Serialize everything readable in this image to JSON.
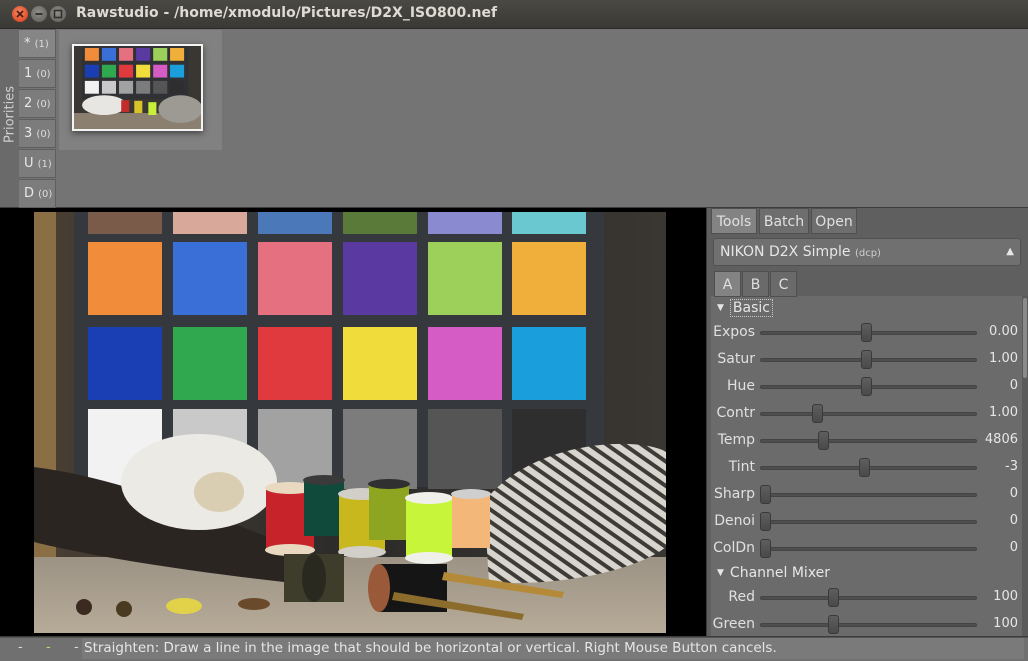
{
  "window": {
    "title": "Rawstudio - /home/xmodulo/Pictures/D2X_ISO800.nef"
  },
  "priorities": {
    "label": "Priorities",
    "tabs": [
      {
        "label": "*",
        "count": "(1)"
      },
      {
        "label": "1",
        "count": "(0)"
      },
      {
        "label": "2",
        "count": "(0)"
      },
      {
        "label": "3",
        "count": "(0)"
      },
      {
        "label": "U",
        "count": "(1)"
      },
      {
        "label": "D",
        "count": "(0)"
      }
    ]
  },
  "tools_tabs": [
    "Tools",
    "Batch",
    "Open"
  ],
  "profile": {
    "name": "NIKON D2X Simple",
    "type": "(dcp)"
  },
  "subtabs": [
    "A",
    "B",
    "C"
  ],
  "basic": {
    "title": "Basic",
    "rows": [
      {
        "label": "Expos",
        "value": "0.00",
        "pos": 0.49
      },
      {
        "label": "Satur",
        "value": "1.00",
        "pos": 0.49
      },
      {
        "label": "Hue",
        "value": "0",
        "pos": 0.49
      },
      {
        "label": "Contr",
        "value": "1.00",
        "pos": 0.25
      },
      {
        "label": "Temp",
        "value": "4806",
        "pos": 0.28
      },
      {
        "label": "Tint",
        "value": "-3",
        "pos": 0.48
      },
      {
        "label": "Sharp",
        "value": "0",
        "pos": 0.0
      },
      {
        "label": "Denoi",
        "value": "0",
        "pos": 0.0
      },
      {
        "label": "ColDn",
        "value": "0",
        "pos": 0.0
      }
    ]
  },
  "channel_mixer": {
    "title": "Channel Mixer",
    "rows": [
      {
        "label": "Red",
        "value": "100",
        "pos": 0.33
      },
      {
        "label": "Green",
        "value": "100",
        "pos": 0.33
      }
    ]
  },
  "statusbar": {
    "mark1": "-",
    "mark2": "-",
    "mark3": "-",
    "text": "Straighten: Draw a line in the image that should be horizontal or vertical. Right Mouse Button cancels."
  },
  "colors": {
    "checker_row1": [
      "#f08c3a",
      "#3a6fd8",
      "#e5707f",
      "#5a3aa0",
      "#9cd05a",
      "#f0ae3a"
    ],
    "checker_row2": [
      "#1a3fb5",
      "#2fa84f",
      "#e03a3e",
      "#f0dc3a",
      "#d45cc4",
      "#1a9fdc"
    ],
    "checker_row3": [
      "#f2f2f2",
      "#c9c9c9",
      "#a2a2a2",
      "#7c7c7c",
      "#555555",
      "#2e2e2e"
    ]
  }
}
